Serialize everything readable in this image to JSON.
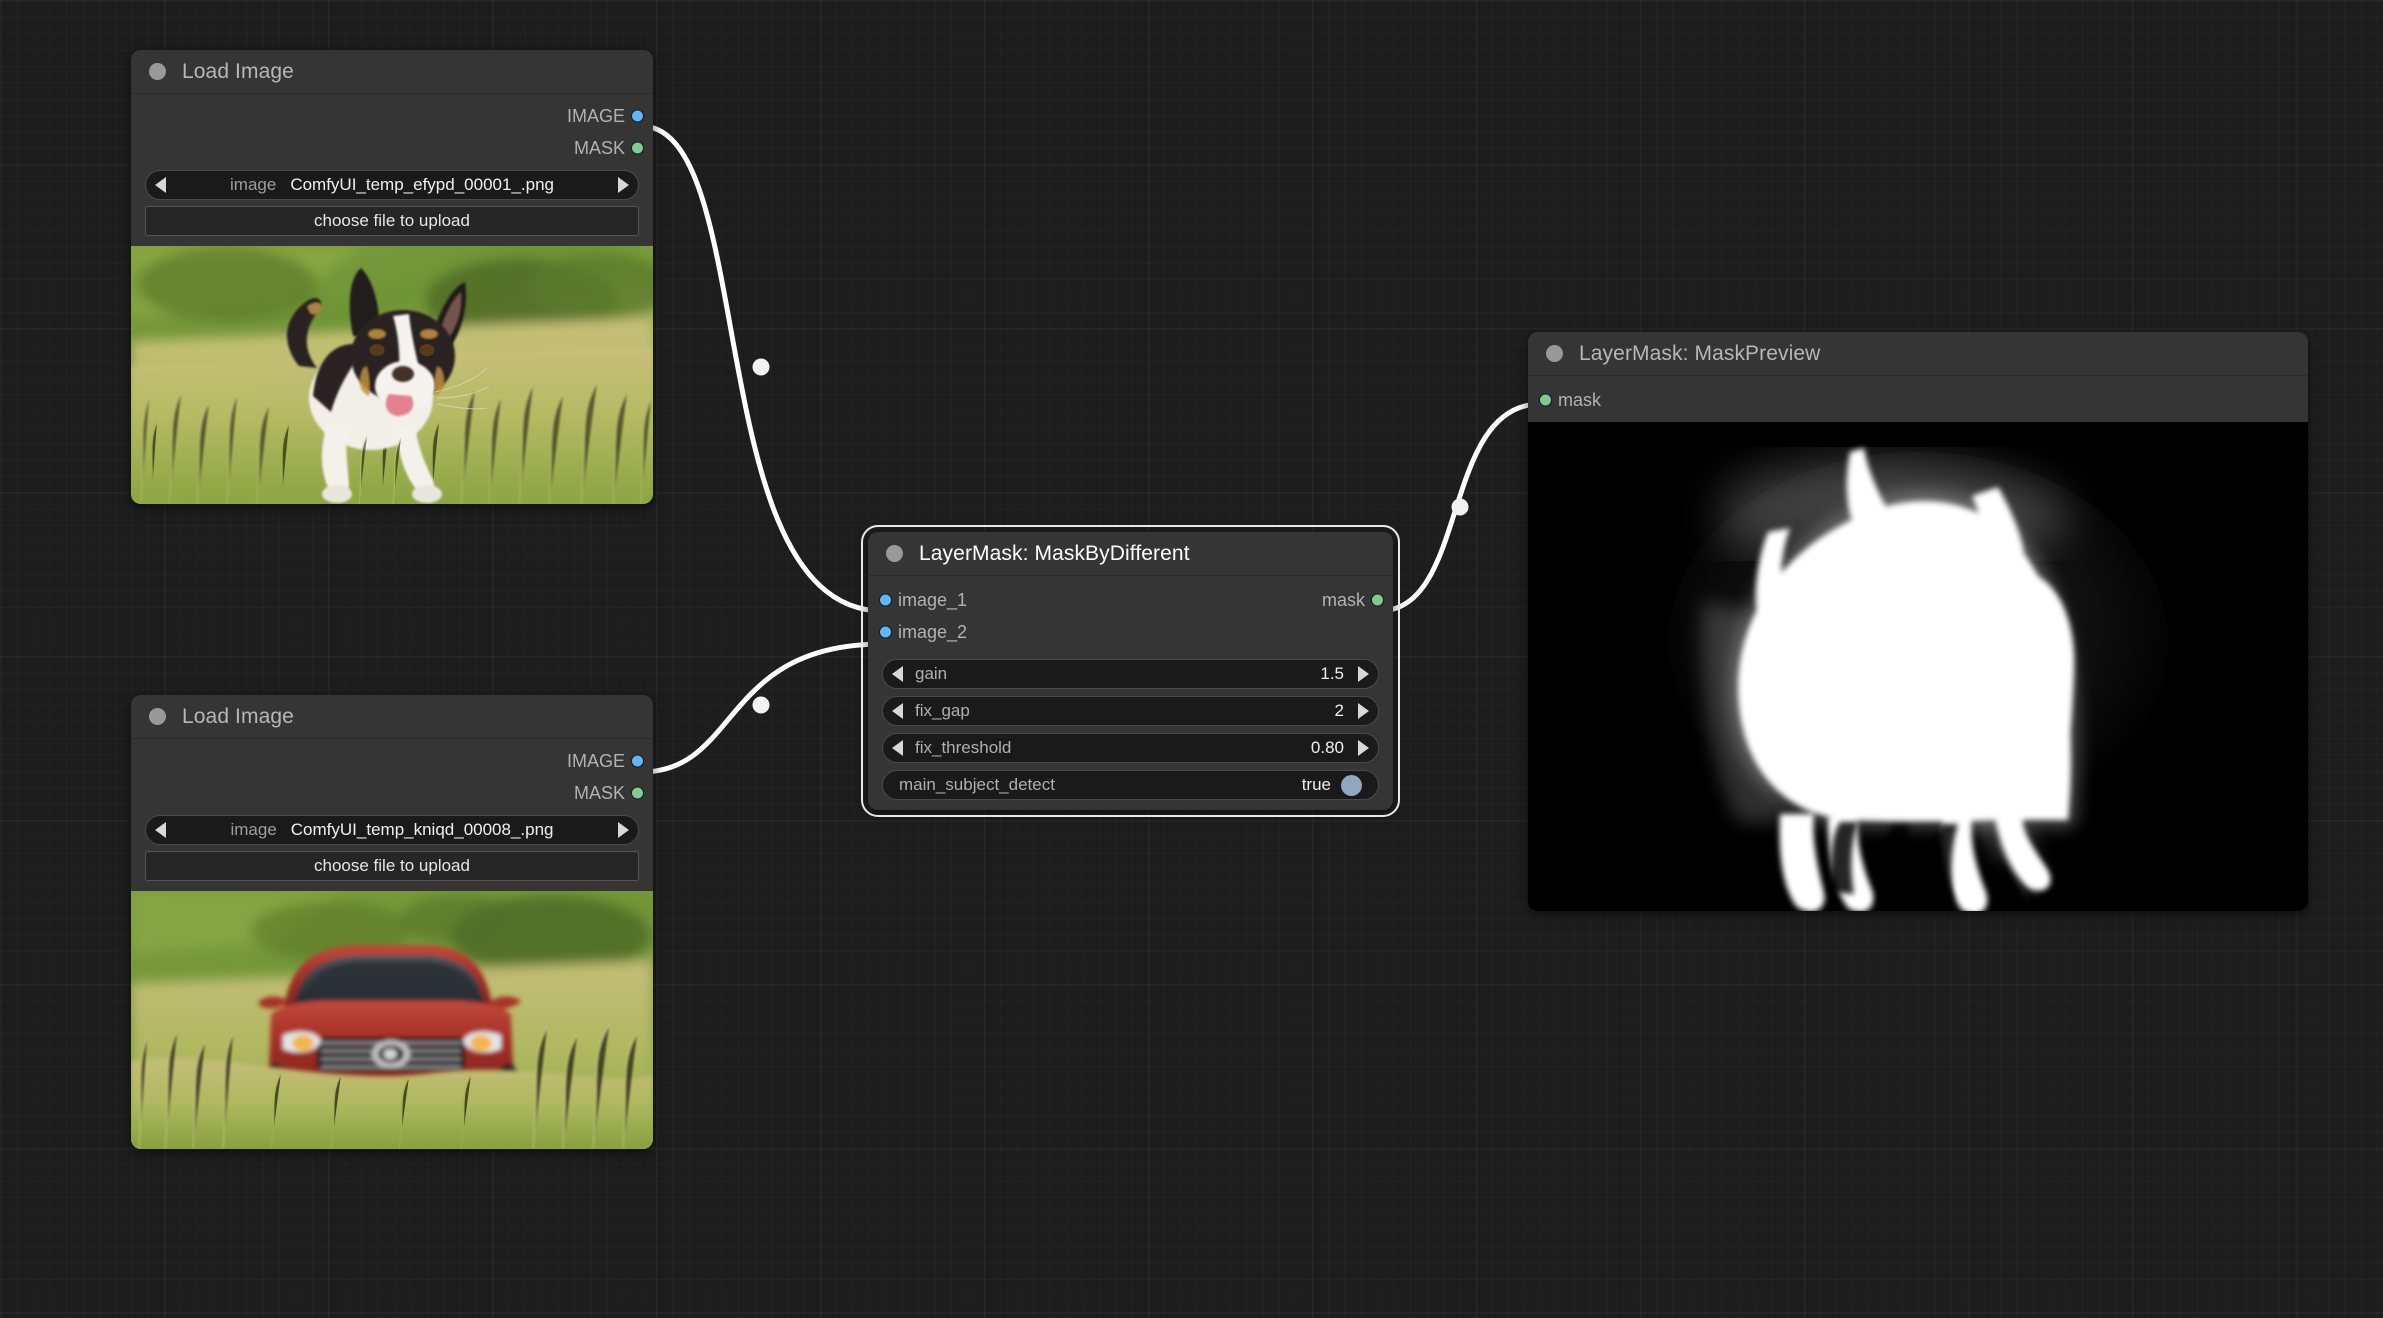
{
  "app": {
    "name": "ComfyUI Node Graph",
    "canvas_background": "#1d1d1d"
  },
  "colors": {
    "node_body": "#353535",
    "widget_background": "#1a1a1a",
    "image_slot": "#64b5f6",
    "mask_slot": "#81c995",
    "link": "#ffffff",
    "toggle_knob": "#8fa8bf"
  },
  "nodes": [
    {
      "id": "load-image-1",
      "title": "Load Image",
      "outputs": [
        {
          "label": "IMAGE",
          "type": "IMAGE"
        },
        {
          "label": "MASK",
          "type": "MASK"
        }
      ],
      "widgets": [
        {
          "name": "image",
          "label": "image",
          "value": "ComfyUI_temp_efypd_00001_.png",
          "type": "combo"
        },
        {
          "name": "upload",
          "label": "choose file to upload",
          "type": "button"
        }
      ],
      "preview": {
        "alt": "A black, white and tan dog leaping through a sunlit grassy meadow"
      }
    },
    {
      "id": "load-image-2",
      "title": "Load Image",
      "outputs": [
        {
          "label": "IMAGE",
          "type": "IMAGE"
        },
        {
          "label": "MASK",
          "type": "MASK"
        }
      ],
      "widgets": [
        {
          "name": "image",
          "label": "image",
          "value": "ComfyUI_temp_kniqd_00008_.png",
          "type": "combo"
        },
        {
          "name": "upload",
          "label": "choose file to upload",
          "type": "button"
        }
      ],
      "preview": {
        "alt": "A red sedan car parked in the same sunlit grassy meadow"
      }
    },
    {
      "id": "mask-by-different",
      "title": "LayerMask: MaskByDifferent",
      "selected": true,
      "inputs": [
        {
          "label": "image_1",
          "type": "IMAGE"
        },
        {
          "label": "image_2",
          "type": "IMAGE"
        }
      ],
      "outputs": [
        {
          "label": "mask",
          "type": "MASK"
        }
      ],
      "widgets": [
        {
          "name": "gain",
          "label": "gain",
          "value": "1.5",
          "type": "number"
        },
        {
          "name": "fix_gap",
          "label": "fix_gap",
          "value": "2",
          "type": "number"
        },
        {
          "name": "fix_threshold",
          "label": "fix_threshold",
          "value": "0.80",
          "type": "number"
        },
        {
          "name": "main_subject_detect",
          "label": "main_subject_detect",
          "value": "true",
          "type": "toggle"
        }
      ]
    },
    {
      "id": "mask-preview",
      "title": "LayerMask: MaskPreview",
      "inputs": [
        {
          "label": "mask",
          "type": "MASK"
        }
      ],
      "preview": {
        "alt": "Black and white alpha mask showing the white silhouette of the dog"
      }
    }
  ],
  "links": [
    {
      "from": "load-image-1.IMAGE",
      "to": "mask-by-different.image_1"
    },
    {
      "from": "load-image-2.IMAGE",
      "to": "mask-by-different.image_2"
    },
    {
      "from": "mask-by-different.mask",
      "to": "mask-preview.mask"
    }
  ]
}
